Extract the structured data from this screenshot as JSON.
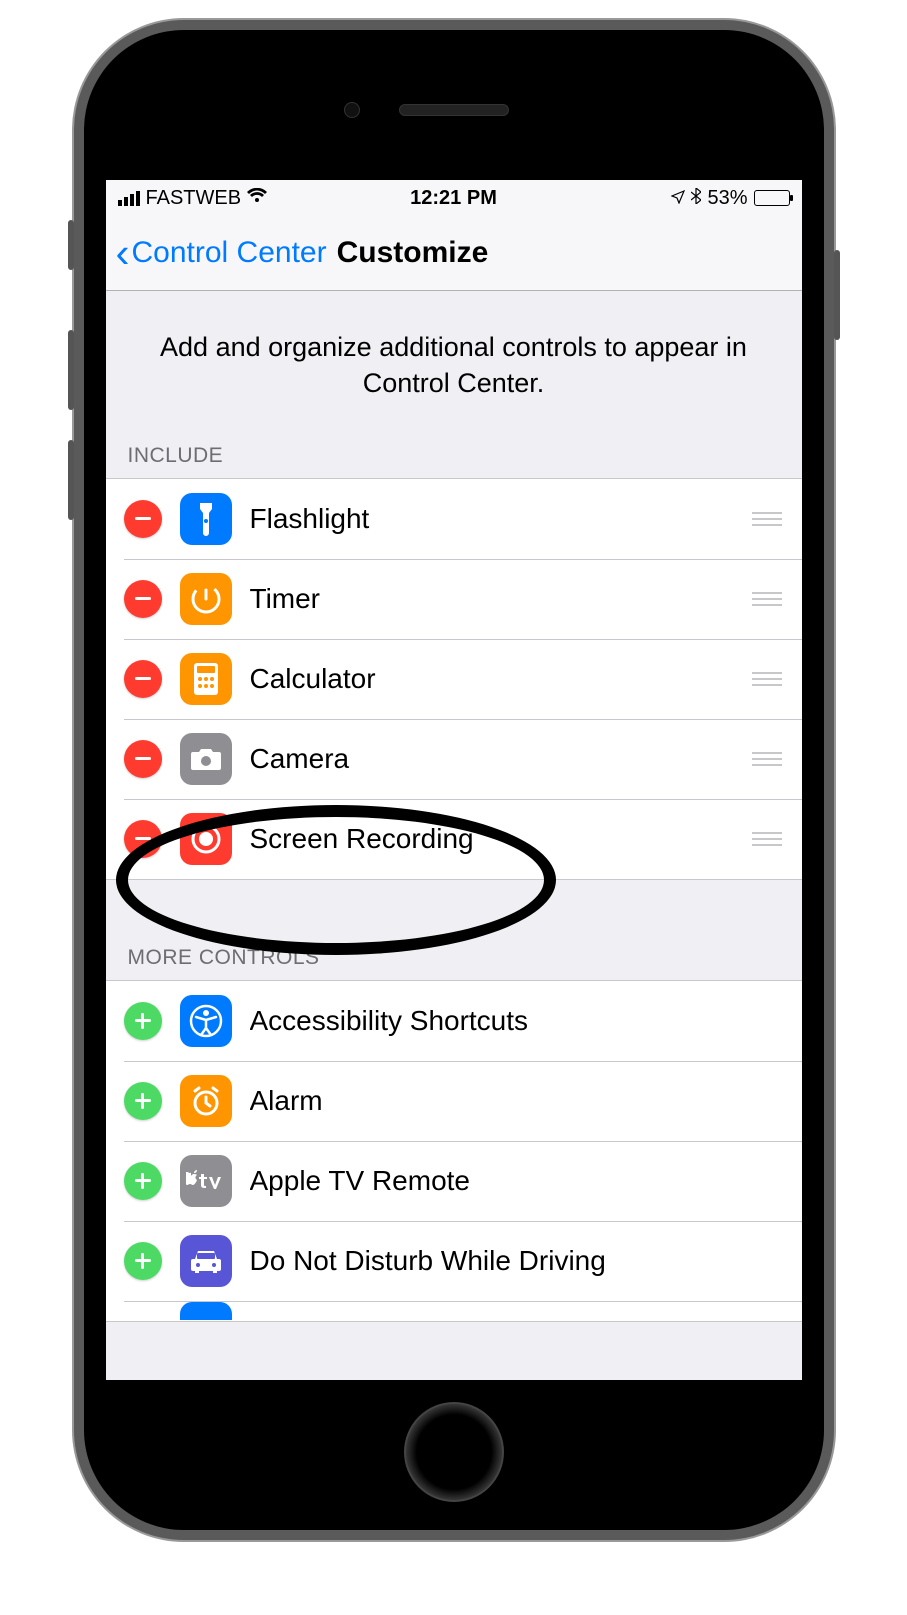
{
  "status": {
    "carrier": "FASTWEB",
    "time": "12:21 PM",
    "battery_pct": "53%"
  },
  "nav": {
    "back_label": "Control Center",
    "title": "Customize"
  },
  "intro": "Add and organize additional controls to appear in Control Center.",
  "sections": {
    "include_label": "INCLUDE",
    "more_label": "MORE CONTROLS"
  },
  "include": [
    {
      "label": "Flashlight",
      "icon": "flashlight",
      "color": "#007aff"
    },
    {
      "label": "Timer",
      "icon": "timer",
      "color": "#ff9500"
    },
    {
      "label": "Calculator",
      "icon": "calculator",
      "color": "#ff9500"
    },
    {
      "label": "Camera",
      "icon": "camera",
      "color": "#8e8e93"
    },
    {
      "label": "Screen Recording",
      "icon": "record",
      "color": "#ff3b30"
    }
  ],
  "more": [
    {
      "label": "Accessibility Shortcuts",
      "icon": "accessibility",
      "color": "#007aff"
    },
    {
      "label": "Alarm",
      "icon": "alarm",
      "color": "#ff9500"
    },
    {
      "label": "Apple TV Remote",
      "icon": "appletv",
      "color": "#8e8e93"
    },
    {
      "label": "Do Not Disturb While Driving",
      "icon": "car",
      "color": "#5856d6"
    }
  ],
  "annotation": {
    "highlighted_item": "Screen Recording"
  }
}
